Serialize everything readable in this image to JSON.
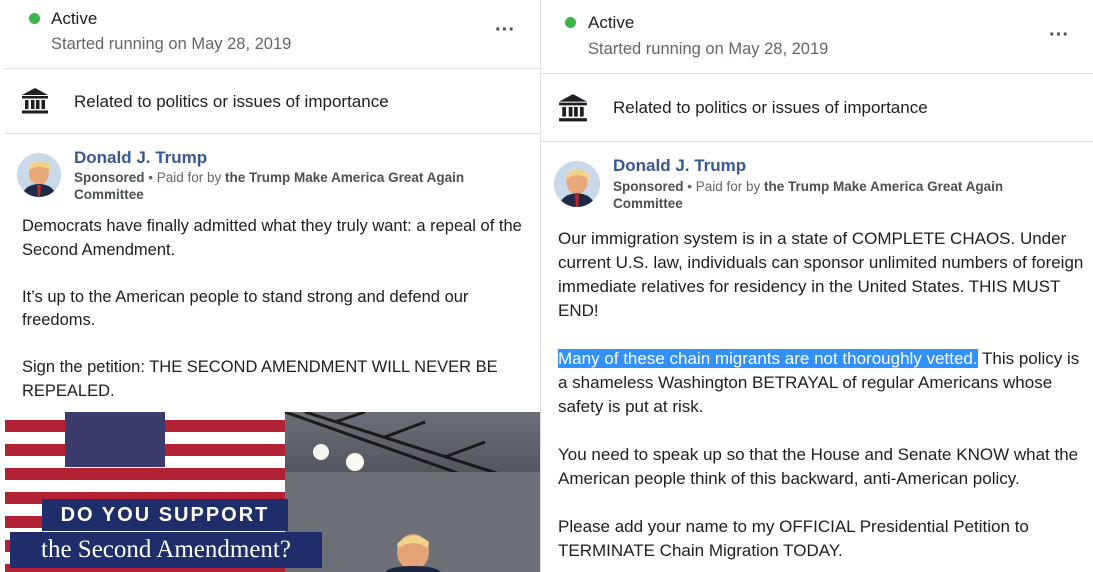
{
  "left_ad": {
    "status": "Active",
    "started": "Started running on May 28, 2019",
    "more_label": "···",
    "category": "Related to politics or issues of importance",
    "advertiser": "Donald J. Trump",
    "sponsored": "Sponsored",
    "paid_for_prefix": " • Paid for by ",
    "paid_for_by": "the Trump Make America Great Again Committee",
    "paragraphs": [
      "Democrats have finally admitted what they truly want: a repeal of the Second Amendment.",
      "It’s up to the American people to stand strong and defend our freedoms.",
      "Sign the petition: THE SECOND AMENDMENT WILL NEVER BE REPEALED."
    ],
    "image_text": {
      "line1": "DO YOU SUPPORT",
      "line2": "the Second Amendment?"
    }
  },
  "right_ad": {
    "status": "Active",
    "started": "Started running on May 28, 2019",
    "more_label": "···",
    "category": "Related to politics or issues of importance",
    "advertiser": "Donald J. Trump",
    "sponsored": "Sponsored",
    "paid_for_prefix": " • Paid for by ",
    "paid_for_by": "the Trump Make America Great Again Committee",
    "paragraph1": "Our immigration system is in a state of COMPLETE CHAOS. Under current U.S. law, individuals can sponsor unlimited numbers of foreign immediate relatives for residency in the United States. THIS MUST END!",
    "paragraph2_highlighted": "Many of these chain migrants are not thoroughly vetted.",
    "paragraph2_rest": " This policy is a shameless Washington BETRAYAL of regular Americans whose safety is put at risk.",
    "paragraph3": "You need to speak up so that the House and Senate KNOW what the American people think of this backward, anti-American policy.",
    "paragraph4": "Please add your name to my OFFICIAL Presidential Petition to TERMINATE Chain Migration TODAY."
  },
  "colors": {
    "status_green": "#3bb54a",
    "advertiser_blue": "#365899",
    "highlight": "#3390ff",
    "headline_box": "#1f2d6b"
  },
  "icons": [
    "more-options-icon",
    "government-building-icon",
    "advertiser-avatar"
  ]
}
